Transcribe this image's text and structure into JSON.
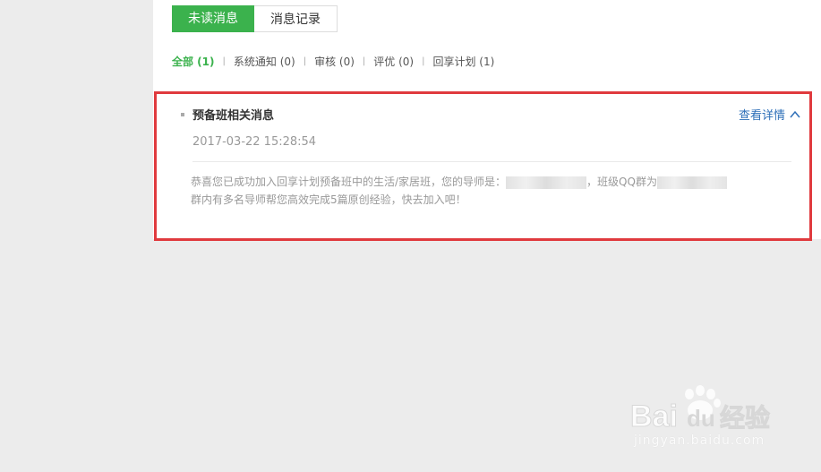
{
  "tabs": [
    {
      "label": "未读消息",
      "active": true
    },
    {
      "label": "消息记录",
      "active": false
    }
  ],
  "filters": [
    {
      "label": "全部 (1)",
      "active": true
    },
    {
      "label": "系统通知 (0)",
      "active": false
    },
    {
      "label": "审核 (0)",
      "active": false
    },
    {
      "label": "评优 (0)",
      "active": false
    },
    {
      "label": "回享计划 (1)",
      "active": false
    }
  ],
  "message": {
    "title": "预备班相关消息",
    "details_label": "查看详情",
    "timestamp": "2017-03-22 15:28:54",
    "body_part1": "恭喜您已成功加入回享计划预备班中的生活/家居班，您的导师是：",
    "body_part2": "，班级QQ群为",
    "body_part3": "群内有多名导师帮您高效完成5篇原创经验，快去加入吧！"
  },
  "watermark": {
    "logo_text": "Baidu经验",
    "site": "jingyan.baidu.com"
  },
  "colors": {
    "accent_green": "#3bb24d",
    "link_blue": "#2e6fb8",
    "highlight_red": "#e03a3e"
  },
  "icons": {
    "details_toggle": "chevron-up-icon"
  }
}
